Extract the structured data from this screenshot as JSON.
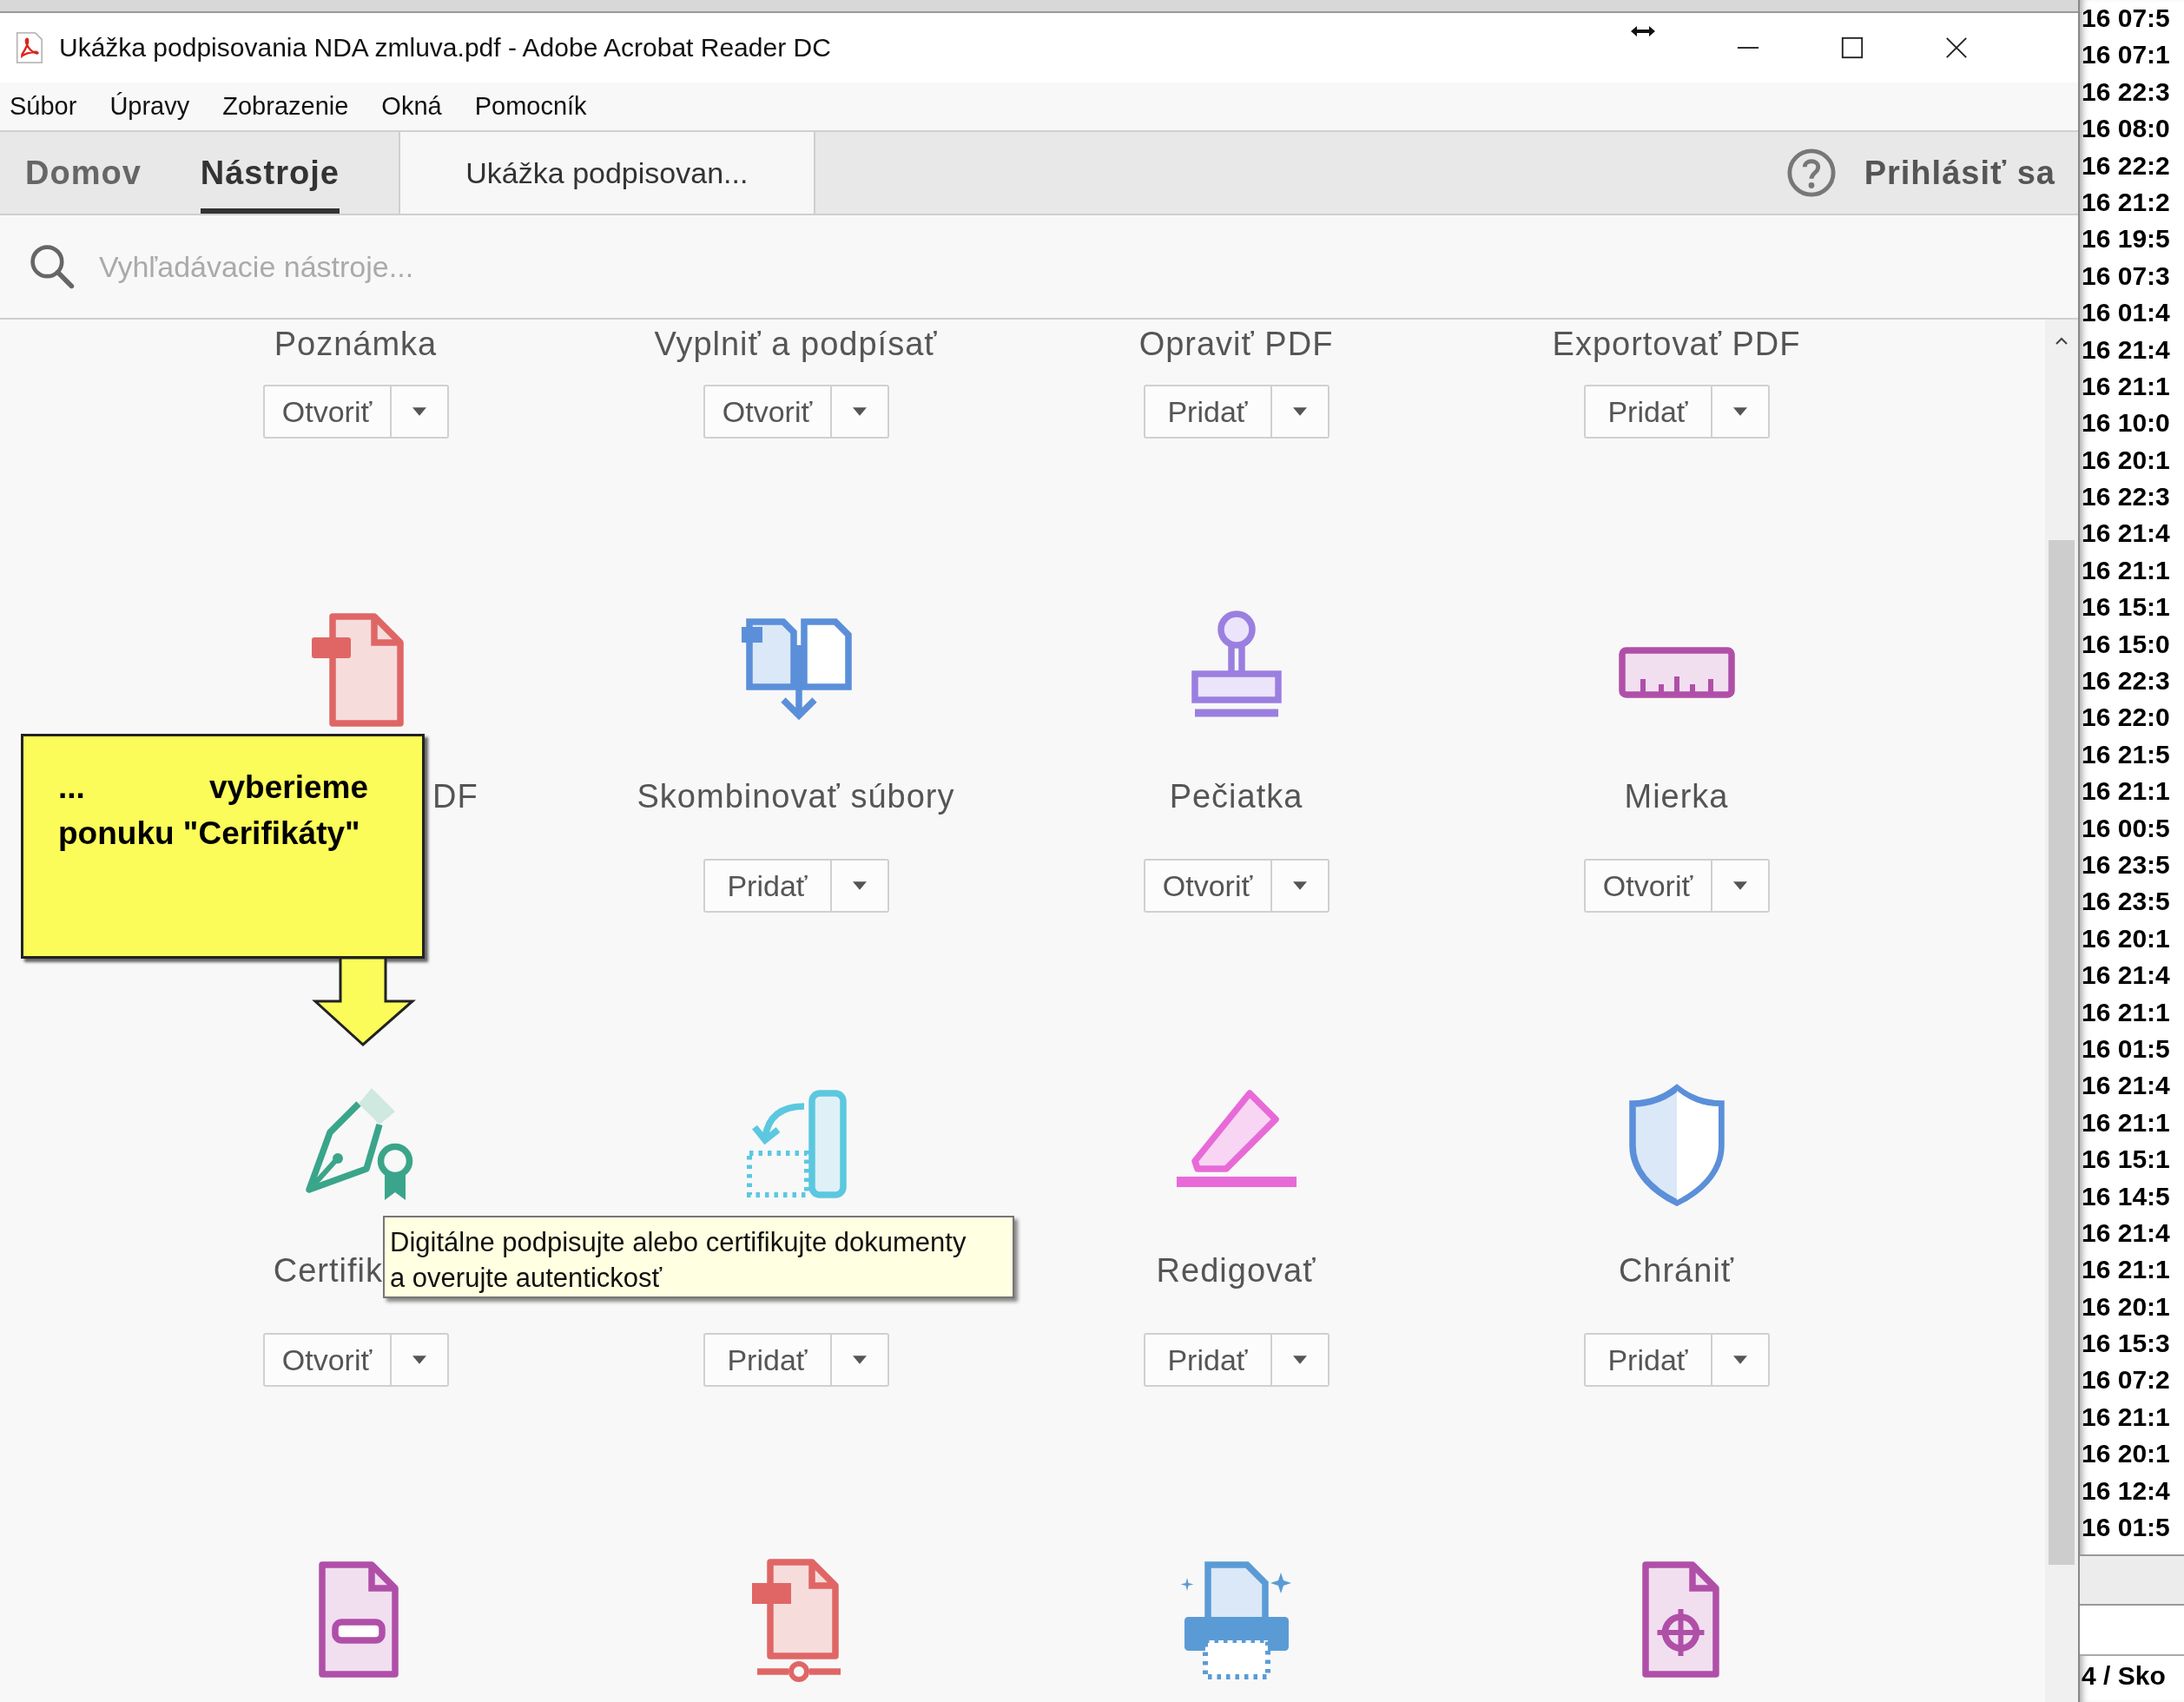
{
  "window": {
    "title": "Ukážka podpisovania NDA zmluva.pdf - Adobe Acrobat Reader DC"
  },
  "menu": [
    "Súbor",
    "Úpravy",
    "Zobrazenie",
    "Okná",
    "Pomocník"
  ],
  "tabs": [
    {
      "label": "Domov",
      "selected": false
    },
    {
      "label": "Nástroje",
      "selected": true
    }
  ],
  "document_tab": {
    "label": "Ukážka podpisovan..."
  },
  "sign_in": "Prihlásiť sa",
  "search": {
    "placeholder": "Vyhľadávacie nástroje..."
  },
  "tools": [
    {
      "kind": "comment",
      "label": "Poznámka",
      "button": "Otvoriť"
    },
    {
      "kind": "fill-sign",
      "label": "Vyplniť a podpísať",
      "button": "Otvoriť"
    },
    {
      "kind": "edit",
      "label": "Opraviť PDF",
      "button": "Pridať"
    },
    {
      "kind": "export",
      "label": "Exportovať PDF",
      "button": "Pridať"
    },
    {
      "kind": "create",
      "label": "DF",
      "covered_left": true
    },
    {
      "kind": "combine",
      "label": "Skombinovať súbory",
      "button": "Pridať"
    },
    {
      "kind": "stamp",
      "label": "Pečiatka",
      "button": "Otvoriť"
    },
    {
      "kind": "measure",
      "label": "Mierka",
      "button": "Otvoriť"
    },
    {
      "kind": "certify",
      "label": "Certifik",
      "covered_right": true,
      "button": "Otvoriť"
    },
    {
      "kind": "send",
      "button": "Pridať"
    },
    {
      "kind": "redact",
      "label": "Redigovať",
      "button": "Pridať"
    },
    {
      "kind": "protect",
      "label": "Chrániť",
      "button": "Pridať"
    },
    {
      "kind": "form"
    },
    {
      "kind": "pdf-share"
    },
    {
      "kind": "scan"
    },
    {
      "kind": "optimize"
    }
  ],
  "callout": {
    "text": "... vyberieme ponuku \"Cerifikáty\""
  },
  "tooltip": {
    "text": "Digitálne podpisujte alebo certifikujte dokumenty\na overujte autentickosť"
  },
  "background_window": {
    "times": [
      "16 07:5",
      "16 07:1",
      "16 22:3",
      "16 08:0",
      "16 22:2",
      "16 21:2",
      "16 19:5",
      "16 07:3",
      "16 01:4",
      "16 21:4",
      "16 21:1",
      "16 10:0",
      "16 20:1",
      "16 22:3",
      "16 21:4",
      "16 21:1",
      "16 15:1",
      "16 15:0",
      "16 22:3",
      "16 22:0",
      "16 21:5",
      "16 21:1",
      "16 00:5",
      "16 23:5",
      "16 23:5",
      "16 20:1",
      "16 21:4",
      "16 21:1",
      "16 01:5",
      "16 21:4",
      "16 21:1",
      "16 15:1",
      "16 14:5",
      "16 21:4",
      "16 21:1",
      "16 20:1",
      "16 15:3",
      "16 07:2",
      "16 21:1",
      "16 20:1",
      "16 12:4",
      "16 01:5"
    ],
    "status": "4 / Sko"
  }
}
